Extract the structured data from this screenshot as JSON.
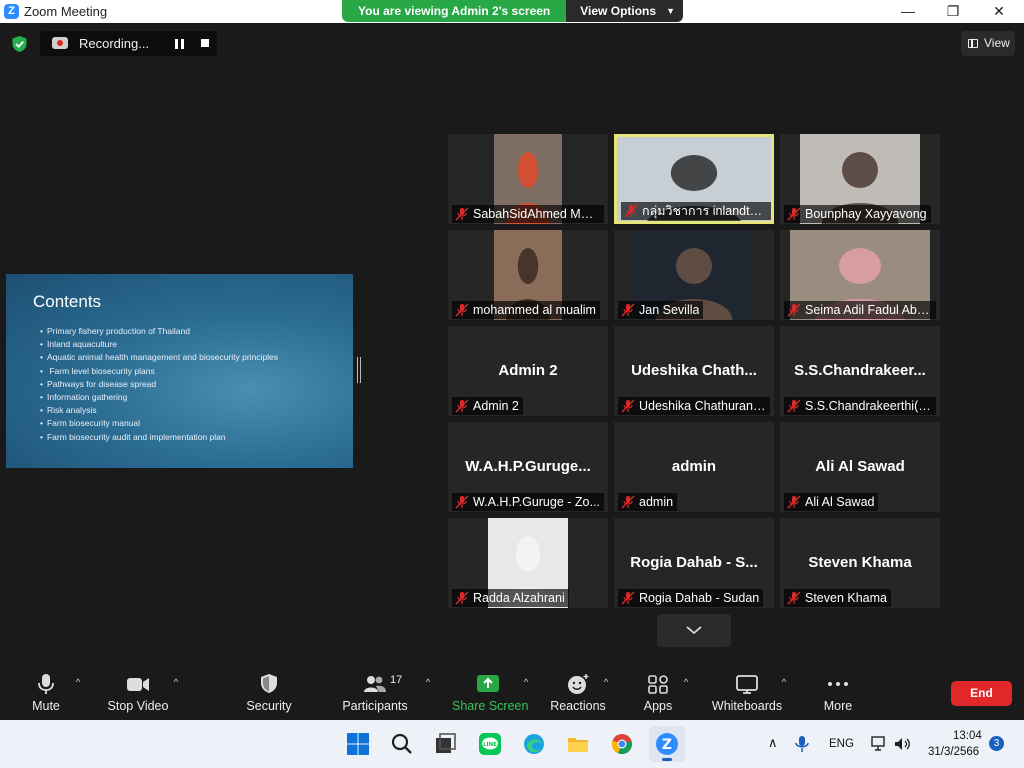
{
  "window": {
    "title": "Zoom Meeting",
    "controls": [
      "minimize",
      "maximize",
      "close"
    ]
  },
  "banner": {
    "message": "You are viewing Admin 2's screen",
    "view_options": "View Options"
  },
  "recording": {
    "label": "Recording..."
  },
  "view_button": {
    "label": "View"
  },
  "slide": {
    "title": "Contents",
    "items": [
      "Primary fishery production of Thailand",
      "Inland aquaculture",
      "Aquatic animal health management and biosecurity principles",
      " Farm level biosecurity plans",
      "Pathways for disease spread",
      "Information gathering",
      "Risk analysis",
      "Farm biosecurity manual",
      "Farm biosecurity audit and implementation plan"
    ]
  },
  "participants": [
    {
      "name": "SabahSidAhmed Moh...",
      "muted": true,
      "has_video": true,
      "active": false,
      "bg": "#7d6d63",
      "fg": "#e24a2a"
    },
    {
      "name": "กลุ่มวิชาการ inlandtechs",
      "muted": true,
      "has_video": true,
      "active": true,
      "bg": "#c7ced4",
      "fg": "#2d2d2d"
    },
    {
      "name": "Bounphay Xayyavong",
      "muted": true,
      "has_video": true,
      "active": false,
      "bg": "#bfbcb8",
      "fg": "#4a3a32"
    },
    {
      "name": "mohammed al mualim",
      "muted": true,
      "has_video": true,
      "active": false,
      "bg": "#8a6c58",
      "fg": "#3a2c25"
    },
    {
      "name": "Jan Sevilla",
      "muted": true,
      "has_video": true,
      "active": false,
      "bg": "#1f2630",
      "fg": "#6b5548"
    },
    {
      "name": "Seima Adil Fadul Abd...",
      "muted": true,
      "has_video": true,
      "active": false,
      "bg": "#9a8c7e",
      "fg": "#e2a0a8"
    },
    {
      "name": "Admin 2",
      "display": "Admin 2",
      "muted": true,
      "has_video": false,
      "active": false
    },
    {
      "name": "Udeshika Chathurani(...",
      "display": "Udeshika  Chath...",
      "muted": true,
      "has_video": false,
      "active": false
    },
    {
      "name": "S.S.Chandrakeerthi(Sr...",
      "display": "S.S.Chandrakeer...",
      "muted": true,
      "has_video": false,
      "active": false
    },
    {
      "name": "W.A.H.P.Guruge - Zo...",
      "display": "W.A.H.P.Guruge...",
      "muted": true,
      "has_video": false,
      "active": false
    },
    {
      "name": "admin",
      "display": "admin",
      "muted": true,
      "has_video": false,
      "active": false
    },
    {
      "name": "Ali Al Sawad",
      "display": "Ali Al Sawad",
      "muted": true,
      "has_video": false,
      "active": false
    },
    {
      "name": "Radda Alzahrani",
      "muted": true,
      "has_video": true,
      "active": false,
      "bg": "#e8e8e8",
      "fg": "#f4f4f4"
    },
    {
      "name": "Rogia Dahab - Sudan",
      "display": "Rogia Dahab - S...",
      "muted": true,
      "has_video": false,
      "active": false
    },
    {
      "name": "Steven Khama",
      "display": "Steven Khama",
      "muted": true,
      "has_video": false,
      "active": false
    }
  ],
  "toolbar": {
    "mute": "Mute",
    "stop_video": "Stop Video",
    "security": "Security",
    "participants": "Participants",
    "participant_count": "17",
    "share_screen": "Share Screen",
    "reactions": "Reactions",
    "apps": "Apps",
    "whiteboards": "Whiteboards",
    "more": "More",
    "end": "End"
  },
  "colors": {
    "share_green": "#28a745",
    "end_red": "#e02828",
    "active_speaker": "#e6e57a",
    "muted_red": "#e02828"
  },
  "taskbar": {
    "apps": [
      "windows-start",
      "search",
      "task-view",
      "line",
      "edge",
      "file-explorer",
      "chrome",
      "zoom"
    ],
    "language": "ENG",
    "time": "13:04",
    "date": "31/3/2566",
    "notification_count": "3"
  }
}
